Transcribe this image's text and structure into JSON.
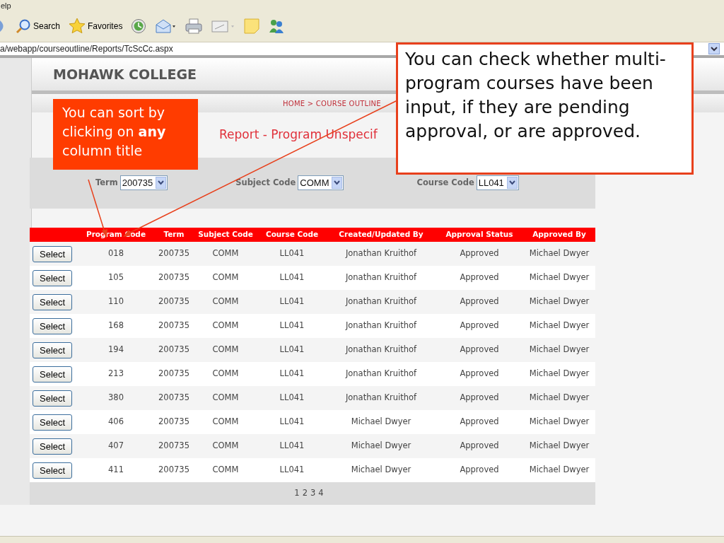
{
  "menu_bar": {
    "items": [
      "elp"
    ]
  },
  "toolbar": {
    "buttons": [
      {
        "kind": "back"
      },
      {
        "kind": "search",
        "label": "Search"
      },
      {
        "kind": "favorites",
        "label": "Favorites"
      },
      {
        "kind": "history"
      },
      {
        "kind": "mail"
      },
      {
        "kind": "print"
      },
      {
        "kind": "edit"
      },
      {
        "kind": "note"
      },
      {
        "kind": "messenger"
      }
    ]
  },
  "address_bar": {
    "value": "a/webapp/courseoutline/Reports/TcScCc.aspx"
  },
  "page": {
    "site_title": "MOHAWK COLLEGE",
    "breadcrumb": "HOME > COURSE OUTLINE",
    "report_title": "Report - Program Unspecif",
    "filters": [
      {
        "label": "Term",
        "value": "200735"
      },
      {
        "label": "Subject Code",
        "value": "COMM"
      },
      {
        "label": "Course Code",
        "value": "LL041"
      }
    ],
    "table": {
      "columns": [
        "Program Code",
        "Term",
        "Subject Code",
        "Course Code",
        "Created/Updated By",
        "Approval Status",
        "Approved By"
      ],
      "rows": [
        {
          "button": "Select",
          "cells": [
            "018",
            "200735",
            "COMM",
            "LL041",
            "Jonathan Kruithof",
            "Approved",
            "Michael Dwyer"
          ]
        },
        {
          "button": "Select",
          "cells": [
            "105",
            "200735",
            "COMM",
            "LL041",
            "Jonathan Kruithof",
            "Approved",
            "Michael Dwyer"
          ]
        },
        {
          "button": "Select",
          "cells": [
            "110",
            "200735",
            "COMM",
            "LL041",
            "Jonathan Kruithof",
            "Approved",
            "Michael Dwyer"
          ]
        },
        {
          "button": "Select",
          "cells": [
            "168",
            "200735",
            "COMM",
            "LL041",
            "Jonathan Kruithof",
            "Approved",
            "Michael Dwyer"
          ]
        },
        {
          "button": "Select",
          "cells": [
            "194",
            "200735",
            "COMM",
            "LL041",
            "Jonathan Kruithof",
            "Approved",
            "Michael Dwyer"
          ]
        },
        {
          "button": "Select",
          "cells": [
            "213",
            "200735",
            "COMM",
            "LL041",
            "Jonathan Kruithof",
            "Approved",
            "Michael Dwyer"
          ]
        },
        {
          "button": "Select",
          "cells": [
            "380",
            "200735",
            "COMM",
            "LL041",
            "Jonathan Kruithof",
            "Approved",
            "Michael Dwyer"
          ]
        },
        {
          "button": "Select",
          "cells": [
            "406",
            "200735",
            "COMM",
            "LL041",
            "Michael Dwyer",
            "Approved",
            "Michael Dwyer"
          ]
        },
        {
          "button": "Select",
          "cells": [
            "407",
            "200735",
            "COMM",
            "LL041",
            "Michael Dwyer",
            "Approved",
            "Michael Dwyer"
          ]
        },
        {
          "button": "Select",
          "cells": [
            "411",
            "200735",
            "COMM",
            "LL041",
            "Michael Dwyer",
            "Approved",
            "Michael Dwyer"
          ]
        }
      ],
      "pages": [
        "1",
        "2",
        "3",
        "4"
      ]
    }
  },
  "callouts": [
    {
      "kind": "filled",
      "text": "You can sort by clicking on **any** column title"
    },
    {
      "kind": "outlined",
      "text": "You can check whether multi-program courses have been input, if they are pending approval, or are approved."
    }
  ]
}
